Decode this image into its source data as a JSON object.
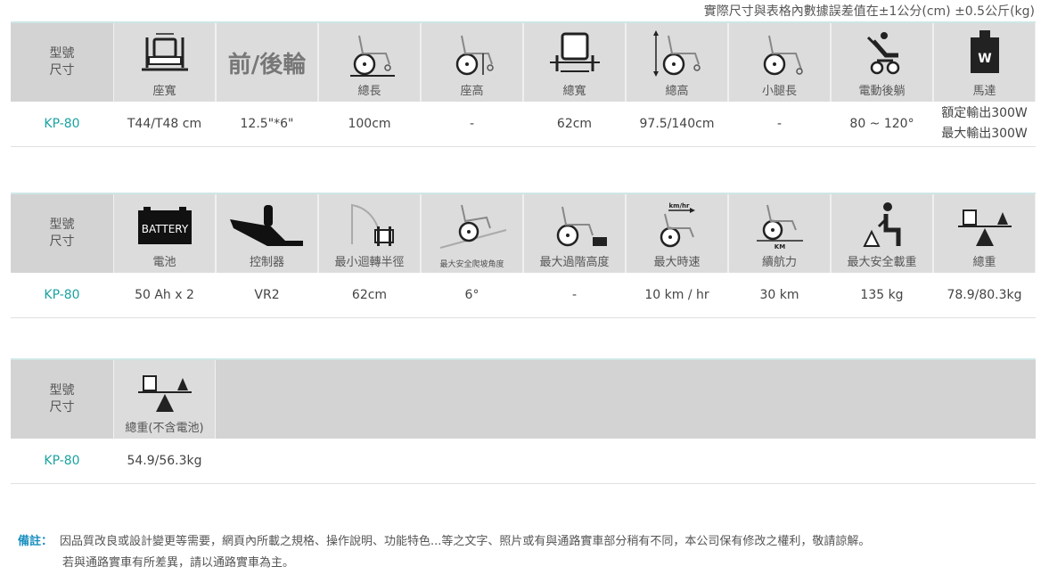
{
  "tolerance_note": "實際尺寸與表格內數據誤差值在±1公分(cm) ±0.5公斤(kg)",
  "header_label": [
    "型號",
    "尺寸"
  ],
  "table1": {
    "front_rear_wheel_title": "前/後輪",
    "labels": [
      "座寬",
      "總長",
      "座高",
      "總寬",
      "總高",
      "小腿長",
      "電動後躺",
      "馬達"
    ],
    "row": {
      "model": "KP-80",
      "values": [
        "T44/T48 cm",
        "12.5\"*6\"",
        "100cm",
        "-",
        "62cm",
        "97.5/140cm",
        "-",
        "80 ~ 120°"
      ],
      "motor": [
        "額定輸出300W",
        "最大輸出300W"
      ]
    }
  },
  "table2": {
    "battery_icon_text": "BATTERY",
    "speed_icon_text": "km/hr",
    "range_icon_text": "KM",
    "labels": [
      "電池",
      "控制器",
      "最小迴轉半徑",
      "最大安全爬坡角度",
      "最大過階高度",
      "最大時速",
      "續航力",
      "最大安全載重",
      "總重"
    ],
    "row": {
      "model": "KP-80",
      "values": [
        "50 Ah x 2",
        "VR2",
        "62cm",
        "6°",
        "-",
        "10 km / hr",
        "30 km",
        "135 kg",
        "78.9/80.3kg"
      ]
    }
  },
  "table3": {
    "labels": [
      "總重(不含電池)"
    ],
    "row": {
      "model": "KP-80",
      "values": [
        "54.9/56.3kg"
      ]
    }
  },
  "motor_icon_text": "W",
  "footnote": {
    "tag": "備註：",
    "line1": "因品質改良或設計變更等需要，網頁內所載之規格、操作說明、功能特色...等之文字、照片或有與通路實車部分稍有不同，本公司保有修改之權利，敬請諒解。",
    "line2": "若與通路實車有所差異，請以通路實車為主。"
  }
}
